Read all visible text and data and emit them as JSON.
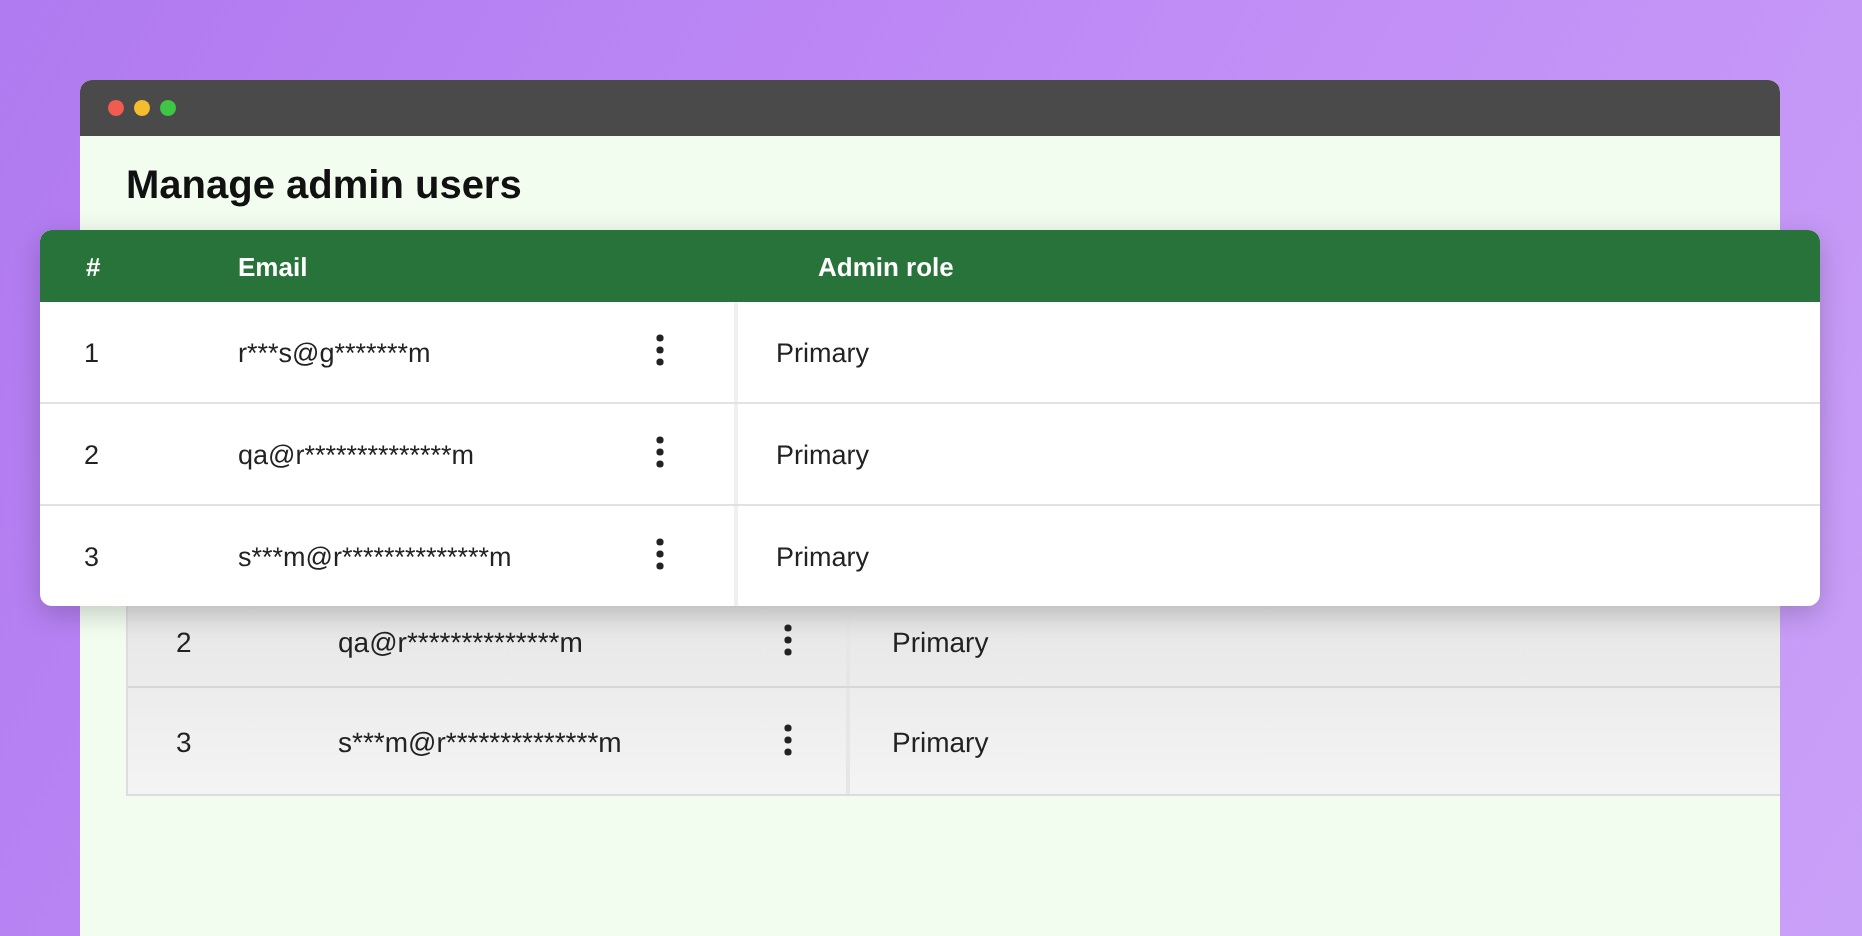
{
  "window": {
    "title": "Manage admin users"
  },
  "background_table": {
    "rows": [
      {
        "index": "2",
        "email": "qa@r**************m",
        "role": "Primary"
      },
      {
        "index": "3",
        "email": "s***m@r**************m",
        "role": "Primary"
      }
    ]
  },
  "table": {
    "columns": [
      "#",
      "Email",
      "Admin role"
    ],
    "rows": [
      {
        "index": "1",
        "email": "r***s@g*******m",
        "role": "Primary"
      },
      {
        "index": "2",
        "email": "qa@r**************m",
        "role": "Primary"
      },
      {
        "index": "3",
        "email": "s***m@r**************m",
        "role": "Primary"
      }
    ]
  }
}
